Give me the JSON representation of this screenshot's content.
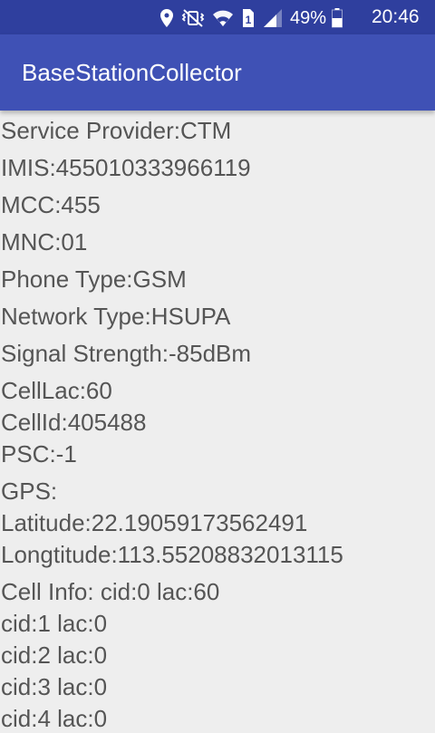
{
  "status_bar": {
    "battery_percent": "49%",
    "time": "20:46",
    "sim_indicator": "1",
    "icons": [
      "location-icon",
      "vibrate-icon",
      "wifi-icon",
      "sim-icon",
      "signal-icon",
      "battery-icon"
    ]
  },
  "app_bar": {
    "title": "BaseStationCollector",
    "color": "#3f51b5"
  },
  "info": {
    "service_provider": "Service Provider:CTM",
    "imis": "IMIS:455010333966119",
    "mcc": "MCC:455",
    "mnc": "MNC:01",
    "phone_type": "Phone Type:GSM",
    "network_type": "Network Type:HSUPA",
    "signal_strength": "Signal Strength:-85dBm",
    "cell_lac": "CellLac:60",
    "cell_id": "CellId:405488",
    "psc": "PSC:-1",
    "gps_label": "GPS:",
    "latitude": "Latitude:22.19059173562491",
    "longtitude": "Longtitude:113.55208832013115",
    "cell_info": "Cell Info: cid:0 lac:60",
    "cells": [
      "cid:1 lac:0",
      "cid:2 lac:0",
      "cid:3 lac:0",
      "cid:4 lac:0"
    ]
  }
}
